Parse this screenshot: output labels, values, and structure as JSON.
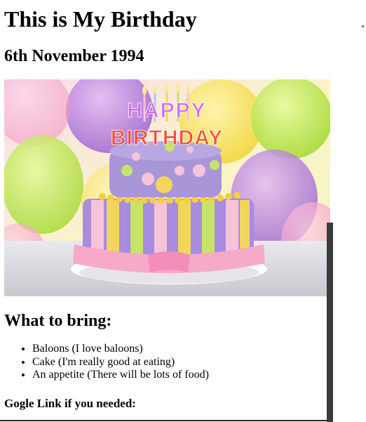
{
  "page": {
    "title": "This is My Birthday",
    "date": "6th November 1994",
    "bring_heading": "What to bring:",
    "items": [
      "Baloons (I love baloons)",
      "Cake (I'm really good at eating)",
      "An appetite (There will be lots of food)"
    ],
    "link_heading": "Gogle Link if you needed:"
  },
  "image": {
    "cake_text_top": "HAPPY",
    "cake_text_bottom": "BIRTHDAY"
  },
  "colors": {
    "scrollbar": "#3a3a3a",
    "accent_dot": "#d0343f"
  }
}
